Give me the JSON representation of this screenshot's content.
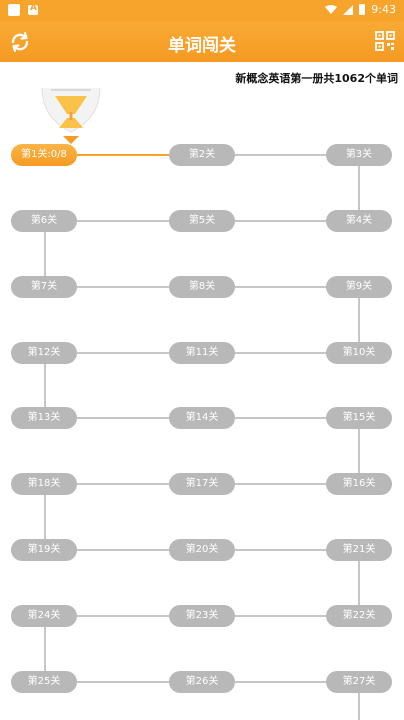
{
  "status": {
    "time": "9:43"
  },
  "header": {
    "title": "单词闯关"
  },
  "book_info": "新概念英语第一册共1062个单词",
  "levels": [
    {
      "label": "第1关:0/8"
    },
    {
      "label": "第2关"
    },
    {
      "label": "第3关"
    },
    {
      "label": "第4关"
    },
    {
      "label": "第5关"
    },
    {
      "label": "第6关"
    },
    {
      "label": "第7关"
    },
    {
      "label": "第8关"
    },
    {
      "label": "第9关"
    },
    {
      "label": "第10关"
    },
    {
      "label": "第11关"
    },
    {
      "label": "第12关"
    },
    {
      "label": "第13关"
    },
    {
      "label": "第14关"
    },
    {
      "label": "第15关"
    },
    {
      "label": "第16关"
    },
    {
      "label": "第17关"
    },
    {
      "label": "第18关"
    },
    {
      "label": "第19关"
    },
    {
      "label": "第20关"
    },
    {
      "label": "第21关"
    },
    {
      "label": "第22关"
    },
    {
      "label": "第23关"
    },
    {
      "label": "第24关"
    },
    {
      "label": "第25关"
    },
    {
      "label": "第26关"
    },
    {
      "label": "第27关"
    }
  ],
  "colors": {
    "accent": "#f7a42c",
    "locked": "#b8b8b8",
    "line": "#c6c6c6"
  },
  "icons": {
    "left": "refresh-icon",
    "right": "qr-code-icon"
  }
}
